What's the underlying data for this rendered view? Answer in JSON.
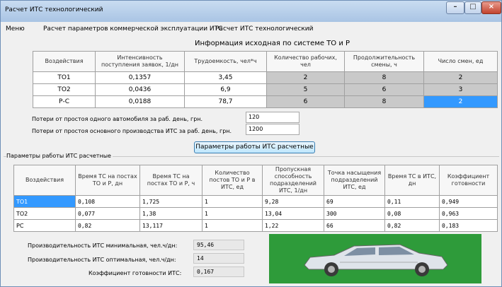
{
  "window": {
    "title": "Расчет ИТС технологический",
    "close_glyph": "×",
    "min_glyph": "–",
    "max_glyph": "□"
  },
  "menu": [
    "Меню",
    "Расчет параметров коммерческой эксплуатации ИТС",
    "Расчет ИТС технологический"
  ],
  "info_title": "Информация исходная по системе ТО и Р",
  "table1": {
    "headers": [
      "Воздействия",
      "Интенсивность поступления заявок, 1/дн",
      "Трудоемкость, чел*ч",
      "Количество рабочих, чел",
      "Продолжительность смены, ч",
      "Число смен, ед"
    ],
    "rows": [
      [
        "ТО1",
        "0,1357",
        "3,45",
        "2",
        "8",
        "2"
      ],
      [
        "ТО2",
        "0,0436",
        "6,9",
        "5",
        "6",
        "3"
      ],
      [
        "Р-С",
        "0,0188",
        "78,7",
        "6",
        "8",
        "2"
      ]
    ]
  },
  "loss1": {
    "label": "Потери от простоя одного автомобиля за раб. день, грн.",
    "value": "120"
  },
  "loss2": {
    "label": "Потери от простоя основного производства ИТС за раб. день, грн.",
    "value": "1200"
  },
  "calc_button": "Параметры работы ИТС расчетные",
  "group_title": "Параметры работы ИТС расчетные",
  "table2": {
    "headers": [
      "Воздействия",
      "Время ТС на постах ТО и Р, дн",
      "Время ТС на постах ТО и Р, ч",
      "Количество постов ТО и Р в ИТС, ед",
      "Пропускная способность подразделений ИТС, 1/дн",
      "Точка насыщения подразделений ИТС, ед",
      "Время ТС в ИТС, дн",
      "Коэффициент готовности"
    ],
    "rows": [
      [
        "ТО1",
        "0,108",
        "1,725",
        "1",
        "9,28",
        "69",
        "0,11",
        "0,949"
      ],
      [
        "ТО2",
        "0,077",
        "1,38",
        "1",
        "13,04",
        "300",
        "0,08",
        "0,963"
      ],
      [
        "РС",
        "0,82",
        "13,117",
        "1",
        "1,22",
        "66",
        "0,82",
        "0,183"
      ]
    ]
  },
  "results": {
    "min_label": "Производительность ИТС минимальная, чел.ч/дн:",
    "min_value": "95,46",
    "opt_label": "Производительность ИТС оптимальная, чел.ч/дн:",
    "opt_value": "14",
    "k_label": "Коэффициент готовности ИТС:",
    "k_value": "0,167"
  }
}
